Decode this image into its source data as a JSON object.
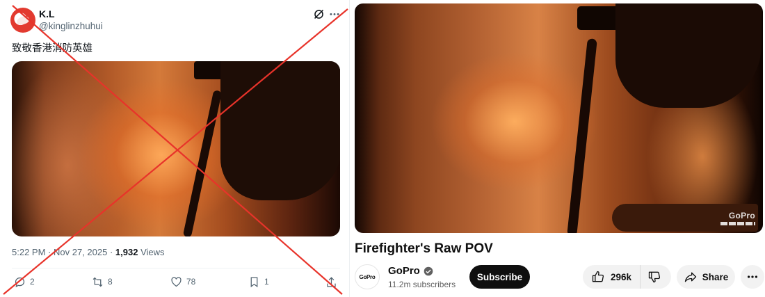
{
  "tweet": {
    "author_name": "K.L",
    "author_handle": "@kinglinzhuhui",
    "text": "致敬香港消防英雄",
    "time": "5:22 PM",
    "date": "Nov 27, 2025",
    "views_count": "1,932",
    "views_label": "Views",
    "replies": "2",
    "reposts": "8",
    "likes": "78",
    "bookmarks": "1",
    "overlay_color": "#e8332a"
  },
  "youtube": {
    "title": "Firefighter's Raw POV",
    "channel_name": "GoPro",
    "channel_avatar_text": "GoPro",
    "subscribers": "11.2m subscribers",
    "subscribe_label": "Subscribe",
    "likes": "296k",
    "share_label": "Share",
    "watermark": "GoPro"
  }
}
